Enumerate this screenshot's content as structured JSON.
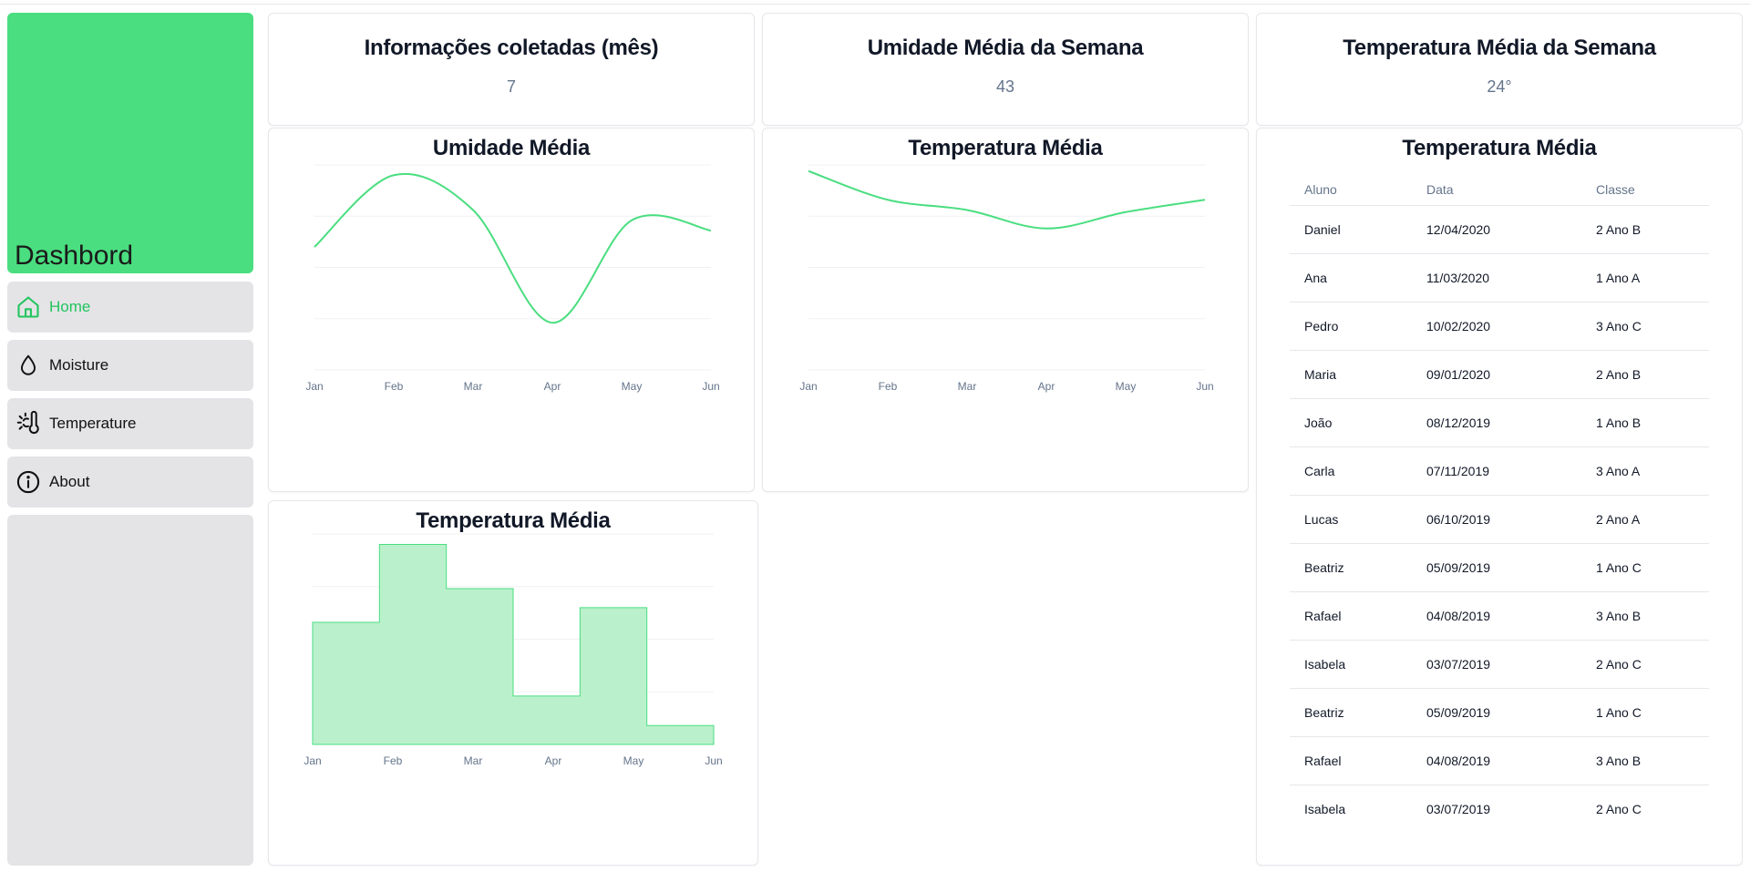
{
  "sidebar": {
    "brand": "Dashbord",
    "items": [
      {
        "label": "Home",
        "icon": "home-icon",
        "active": true
      },
      {
        "label": "Moisture",
        "icon": "droplet-icon"
      },
      {
        "label": "Temperature",
        "icon": "thermometer-sun-icon"
      },
      {
        "label": "About",
        "icon": "info-icon"
      }
    ]
  },
  "stats": [
    {
      "title": "Informações coletadas (mês)",
      "value": "7"
    },
    {
      "title": "Umidade Média da Semana",
      "value": "43"
    },
    {
      "title": "Temperatura Média da Semana",
      "value": "24°"
    }
  ],
  "colors": {
    "accent": "#4ade80",
    "accent_dark": "#22c55e",
    "area_fill": "#b6f0c9",
    "nav_bg": "#e4e4e7"
  },
  "chart_data": [
    {
      "type": "line",
      "title": "Umidade Média",
      "categories": [
        "Jan",
        "Feb",
        "Mar",
        "Apr",
        "May",
        "Jun"
      ],
      "values": [
        60,
        95,
        78,
        23,
        73,
        68
      ],
      "ylim": [
        0,
        100
      ],
      "grid": true
    },
    {
      "type": "line",
      "title": "Temperatura Média",
      "categories": [
        "Jan",
        "Feb",
        "Mar",
        "Apr",
        "May",
        "Jun"
      ],
      "values": [
        97,
        83,
        78,
        69,
        77,
        83
      ],
      "ylim": [
        0,
        100
      ],
      "grid": true
    },
    {
      "type": "area",
      "title": "Temperatura Média",
      "categories": [
        "Jan",
        "Feb",
        "Mar",
        "Apr",
        "May",
        "Jun"
      ],
      "values": [
        58,
        95,
        74,
        23,
        65,
        9
      ],
      "ylim": [
        0,
        100
      ],
      "step": true,
      "grid": true
    }
  ],
  "table": {
    "title": "Temperatura Média",
    "columns": [
      "Aluno",
      "Data",
      "Classe"
    ],
    "rows": [
      [
        "Daniel",
        "12/04/2020",
        "2 Ano B"
      ],
      [
        "Ana",
        "11/03/2020",
        "1 Ano A"
      ],
      [
        "Pedro",
        "10/02/2020",
        "3 Ano C"
      ],
      [
        "Maria",
        "09/01/2020",
        "2 Ano B"
      ],
      [
        "João",
        "08/12/2019",
        "1 Ano B"
      ],
      [
        "Carla",
        "07/11/2019",
        "3 Ano A"
      ],
      [
        "Lucas",
        "06/10/2019",
        "2 Ano A"
      ],
      [
        "Beatriz",
        "05/09/2019",
        "1 Ano C"
      ],
      [
        "Rafael",
        "04/08/2019",
        "3 Ano B"
      ],
      [
        "Isabela",
        "03/07/2019",
        "2 Ano C"
      ],
      [
        "Beatriz",
        "05/09/2019",
        "1 Ano C"
      ],
      [
        "Rafael",
        "04/08/2019",
        "3 Ano B"
      ],
      [
        "Isabela",
        "03/07/2019",
        "2 Ano C"
      ]
    ]
  }
}
